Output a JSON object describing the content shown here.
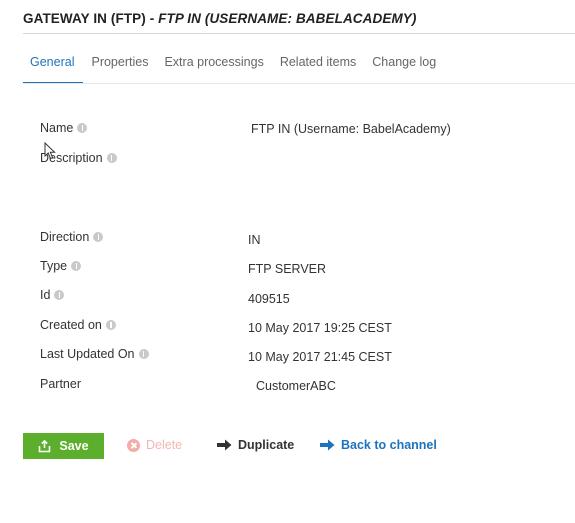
{
  "header": {
    "title_main": "GATEWAY IN (FTP) - ",
    "title_sub": "FTP IN (USERNAME: BABELACADEMY)"
  },
  "tabs": [
    {
      "label": "General",
      "active": true
    },
    {
      "label": "Properties",
      "active": false
    },
    {
      "label": "Extra processings",
      "active": false
    },
    {
      "label": "Related items",
      "active": false
    },
    {
      "label": "Change log",
      "active": false
    }
  ],
  "fields": {
    "name": {
      "label": "Name",
      "value": "FTP IN (Username: BabelAcademy)"
    },
    "description": {
      "label": "Description",
      "value": ""
    },
    "direction": {
      "label": "Direction",
      "value": "IN"
    },
    "type": {
      "label": "Type",
      "value": "FTP SERVER"
    },
    "id": {
      "label": "Id",
      "value": "409515"
    },
    "created_on": {
      "label": "Created on",
      "value": "10 May 2017 19:25 CEST"
    },
    "last_updated_on": {
      "label": "Last Updated On",
      "value": "10 May 2017 21:45 CEST"
    },
    "partner": {
      "label": "Partner",
      "value": "CustomerABC"
    }
  },
  "actions": {
    "save_label": "Save",
    "delete_label": "Delete",
    "duplicate_label": "Duplicate",
    "back_label": "Back to channel"
  },
  "colors": {
    "accent": "#1e73be",
    "save_green": "#5cae2d",
    "delete_disabled": "#f2b7b4"
  },
  "icons": [
    "info-icon",
    "save-icon",
    "delete-icon",
    "duplicate-arrow-icon",
    "back-arrow-icon",
    "mouse-cursor-icon"
  ]
}
